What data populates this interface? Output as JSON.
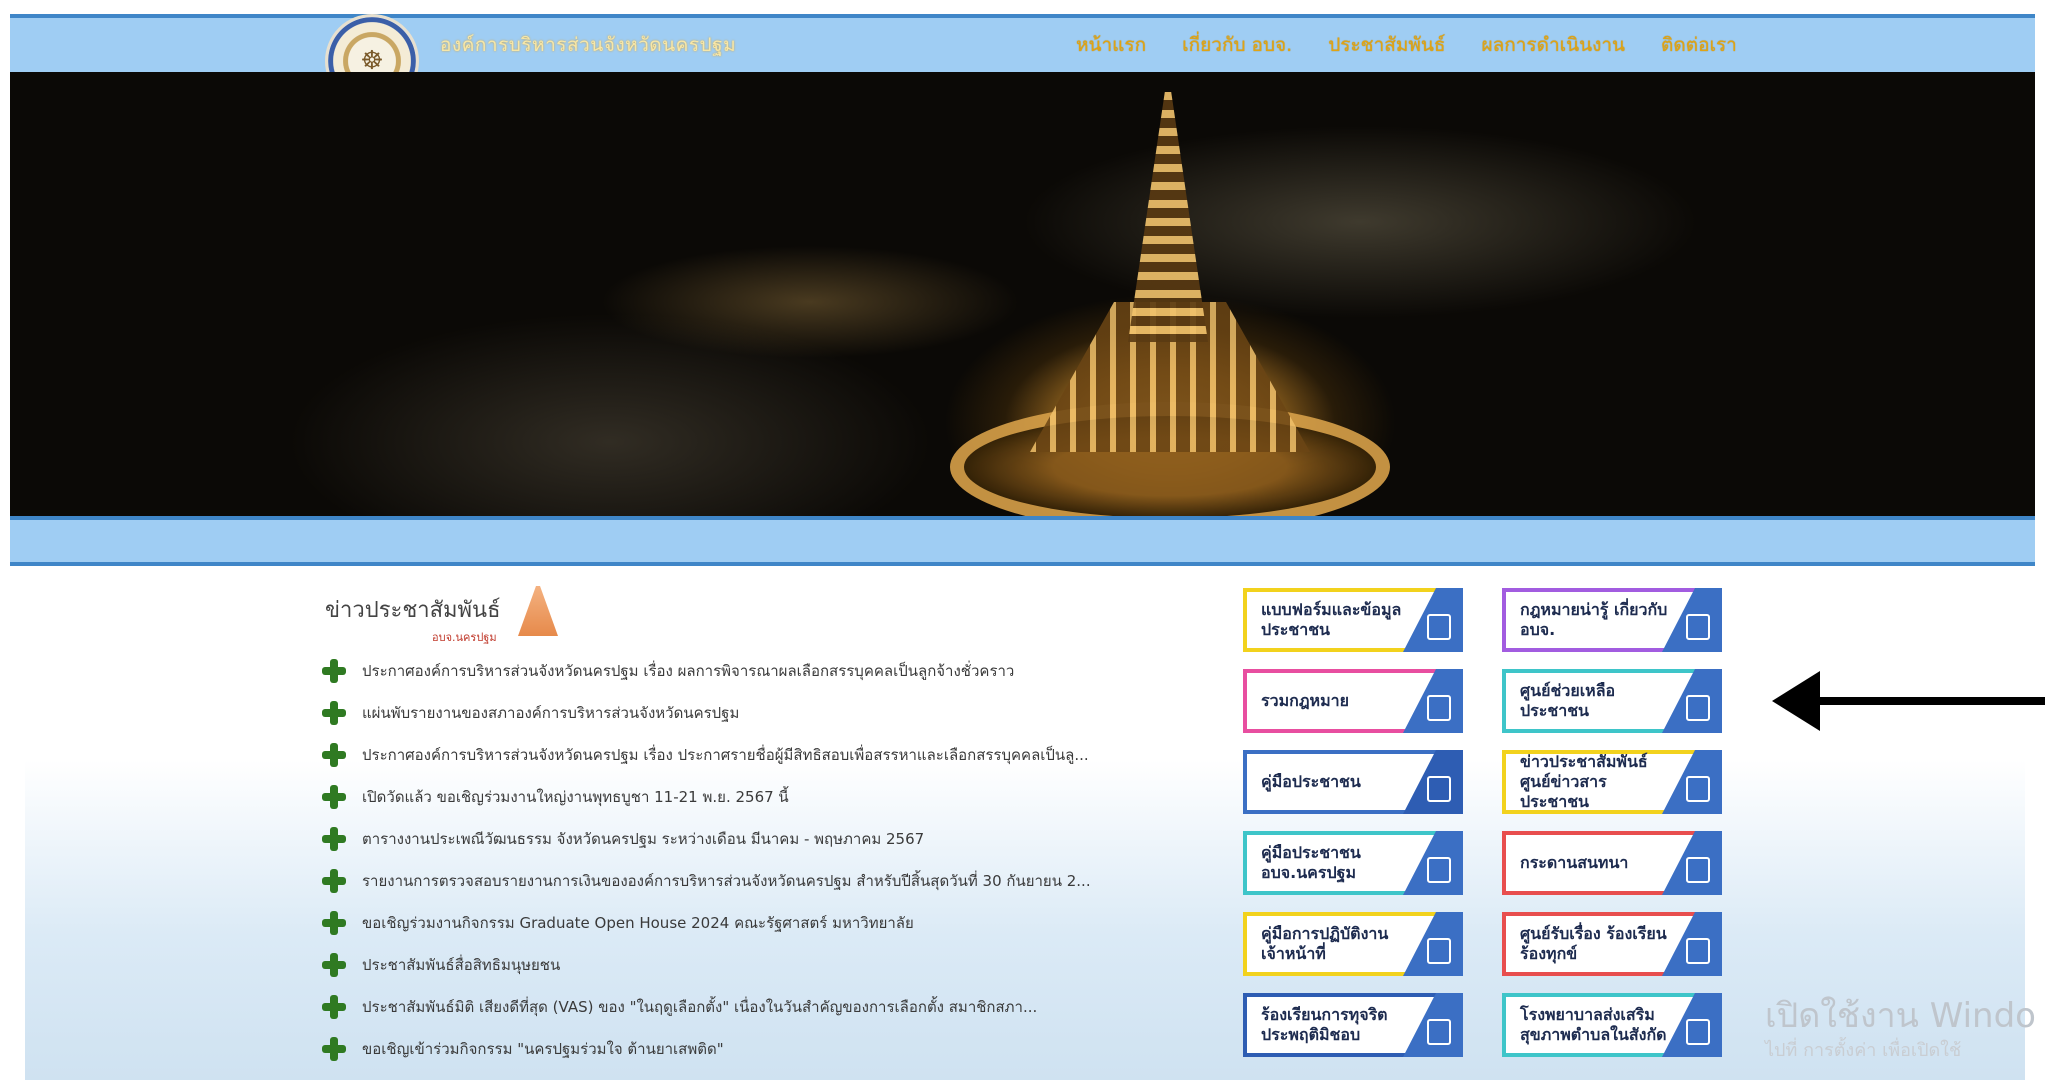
{
  "header": {
    "org_name": "องค์การบริหารส่วนจังหวัดนครปฐม",
    "nav": [
      "หน้าแรก",
      "เกี่ยวกับ อบจ.",
      "ประชาสัมพันธ์",
      "ผลการดำเนินงาน",
      "ติดต่อเรา"
    ]
  },
  "news": {
    "title": "ข่าวประชาสัมพันธ์",
    "subtitle": "อบจ.นครปฐม",
    "items": [
      "ประกาศองค์การบริหารส่วนจังหวัดนครปฐม เรื่อง ผลการพิจารณาผลเลือกสรรบุคคลเป็นลูกจ้างชั่วคราว",
      "แผ่นพับรายงานของสภาองค์การบริหารส่วนจังหวัดนครปฐม",
      "ประกาศองค์การบริหารส่วนจังหวัดนครปฐม เรื่อง ประกาศรายชื่อผู้มีสิทธิสอบเพื่อสรรหาและเลือกสรรบุคคลเป็นลู...",
      "เปิดวัดแล้ว ขอเชิญร่วมงานใหญ่งานพุทธบูชา 11-21 พ.ย. 2567 นี้",
      "ตารางงานประเพณีวัฒนธรรม จังหวัดนครปฐม ระหว่างเดือน มีนาคม - พฤษภาคม 2567",
      "รายงานการตรวจสอบรายงานการเงินขององค์การบริหารส่วนจังหวัดนครปฐม สำหรับปีสิ้นสุดวันที่ 30 กันยายน 2...",
      "ขอเชิญร่วมงานกิจกรรม Graduate Open House 2024 คณะรัฐศาสตร์ มหาวิทยาลัย",
      "ประชาสัมพันธ์สื่อสิทธิมนุษยชน",
      "ประชาสัมพันธ์มิติ เสียงดีที่สุด (VAS) ของ \"ในฤดูเลือกตั้ง\" เนื่องในวันสำคัญของการเลือกตั้ง สมาชิกสภา...",
      "ขอเชิญเข้าร่วมกิจกรรม \"นครปฐมร่วมใจ ต้านยาเสพติด\""
    ]
  },
  "services": [
    {
      "label": "แบบฟอร์มและข้อมูลประชาชน",
      "border": "#f2d21d",
      "corner": "#3b6fc4"
    },
    {
      "label": "กฎหมายน่ารู้ เกี่ยวกับ อบจ.",
      "border": "#a25ce0",
      "corner": "#3b6fc4"
    },
    {
      "label": "รวมกฎหมาย",
      "border": "#e84ea0",
      "corner": "#3b6fc4"
    },
    {
      "label": "ศูนย์ช่วยเหลือ ประชาชน",
      "border": "#3ec5c9",
      "corner": "#3b6fc4"
    },
    {
      "label": "คู่มือประชาชน",
      "border": "#3b6fc4",
      "corner": "#2e5db3"
    },
    {
      "label": "ข่าวประชาสัมพันธ์ ศูนย์ข่าวสารประชาชน",
      "border": "#f2d21d",
      "corner": "#3b6fc4"
    },
    {
      "label": "คู่มือประชาชน อบจ.นครปฐม",
      "border": "#3ec5c9",
      "corner": "#3b6fc4"
    },
    {
      "label": "กระดานสนทนา",
      "border": "#e84e4e",
      "corner": "#3b6fc4"
    },
    {
      "label": "คู่มือการปฏิบัติงาน เจ้าหน้าที่",
      "border": "#f2d21d",
      "corner": "#3b6fc4"
    },
    {
      "label": "ศูนย์รับเรื่อง ร้องเรียนร้องทุกข์",
      "border": "#e84e4e",
      "corner": "#3b6fc4"
    },
    {
      "label": "ร้องเรียนการทุจริต ประพฤติมิชอบ",
      "border": "#2e5db3",
      "corner": "#3b6fc4"
    },
    {
      "label": "โรงพยาบาลส่งเสริม สุขภาพตำบลในสังกัด",
      "border": "#3ec5c9",
      "corner": "#3b6fc4"
    }
  ],
  "watermark": {
    "line1": "เปิดใช้งาน Windo",
    "line2": "ไปที่ การตั้งค่า เพื่อเปิดใช้"
  }
}
